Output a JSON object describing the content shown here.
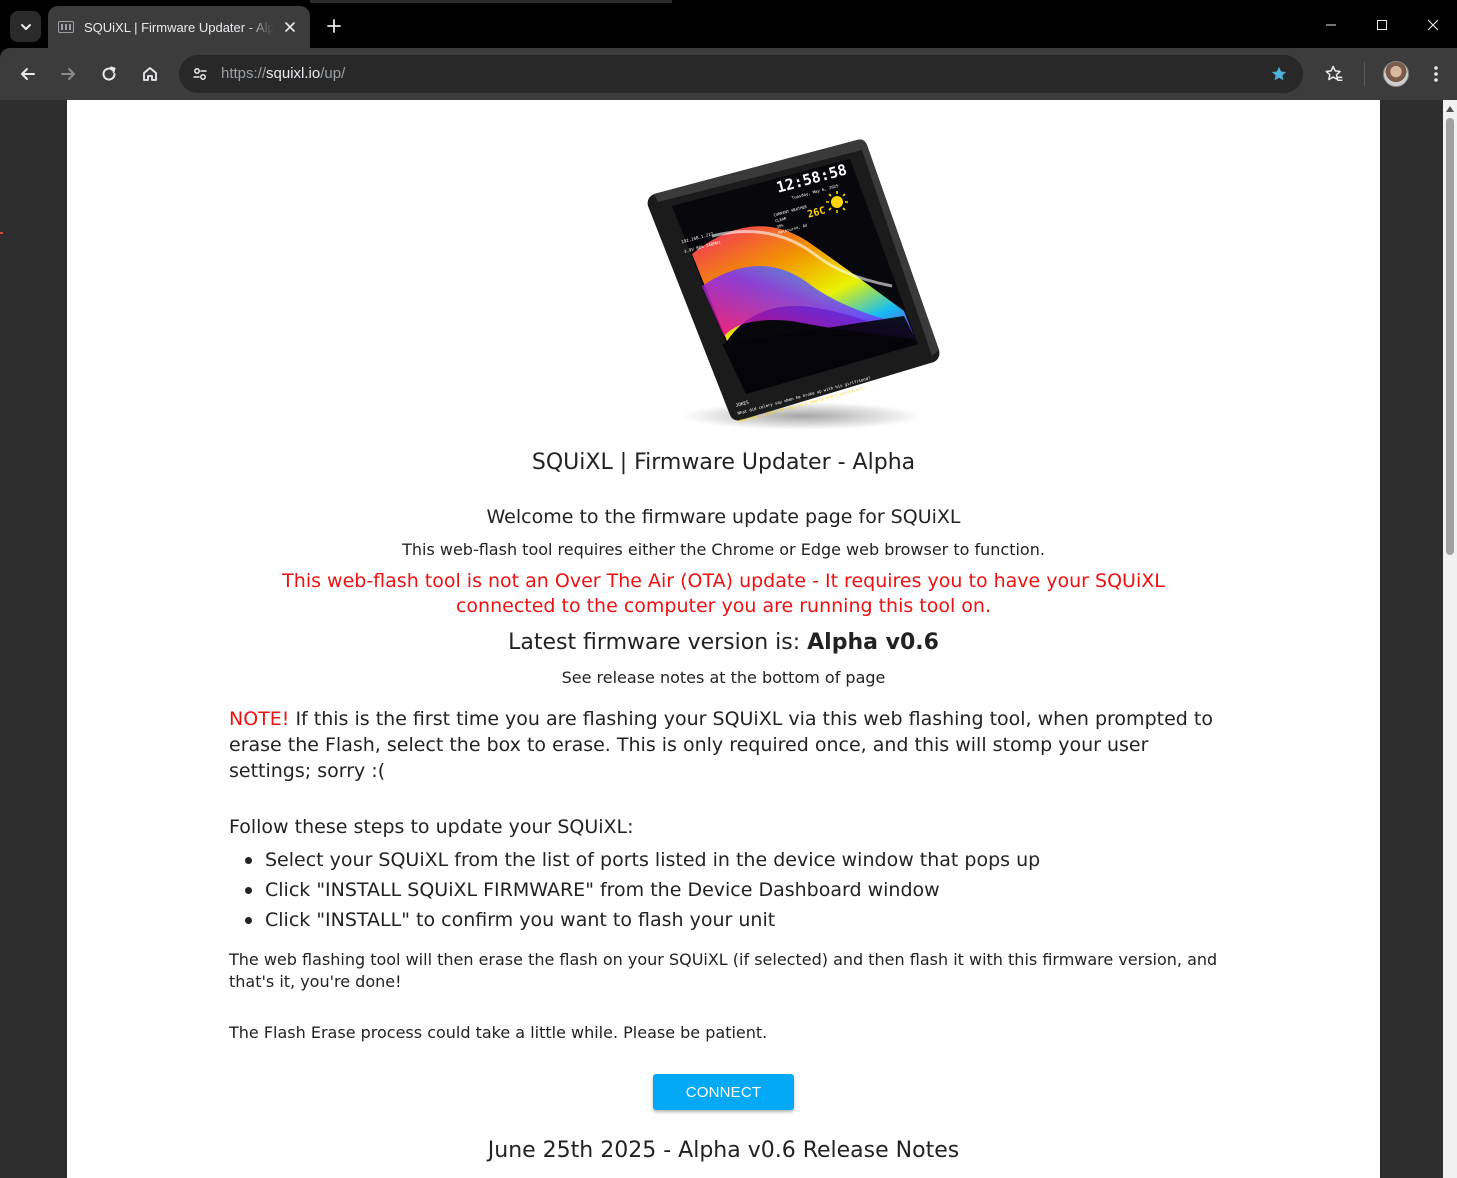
{
  "browser": {
    "tab": {
      "title": "SQUiXL | Firmware Updater - Alpha"
    },
    "address_bar": {
      "scheme": "https://",
      "host": "squixl.io",
      "path": "/up/"
    }
  },
  "page": {
    "title": "SQUiXL | Firmware Updater - Alpha",
    "welcome": "Welcome to the firmware update page for SQUiXL",
    "browser_requirement": "This web-flash tool requires either the Chrome or Edge web browser to function.",
    "ota_warning": "This web-flash tool is not an Over The Air (OTA) update - It requires you to have your SQUiXL connected to the computer you are running this tool on.",
    "latest_label": "Latest firmware version is: ",
    "latest_version": "Alpha v0.6",
    "release_hint": "See release notes at the bottom of page",
    "note_tag": "NOTE!",
    "note_text": " If this is the first time you are flashing your SQUiXL via this web flashing tool, when prompted to erase the Flash, select the box to erase. This is only required once, and this will stomp your user settings; sorry :(",
    "steps_heading": "Follow these steps to update your SQUiXL:",
    "steps": [
      "Select your SQUiXL from the list of ports listed in the device window that pops up",
      "Click \"INSTALL SQUiXL FIRMWARE\" from the Device Dashboard window",
      "Click \"INSTALL\" to confirm you want to flash your unit"
    ],
    "then_text": "The web flashing tool will then erase the flash on your SQUiXL (if selected) and then flash it with this firmware version, and that's it, you're done!",
    "patience_text": "The Flash Erase process could take a little while. Please be patient.",
    "connect_label": "CONNECT",
    "release_notes_title": "June 25th 2025 - Alpha v0.6 Release Notes",
    "device_screen": {
      "time": "12:58:58",
      "date": "Tuesday, May 6, 2025",
      "ip": "192.168.1.217",
      "wifi_info": "3.9V 80% 240MHz",
      "weather_label": "CURRENT WEATHER",
      "weather_cond": "CLEAR",
      "weather_extra": "38%",
      "location": "Melbourne, AU",
      "temperature": "26C",
      "jokes_title": "JOKES",
      "joke_q": "What did celery say when he broke up with his girlfriend?",
      "joke_a": "She wasn't right for me, so I really don't carrot all."
    }
  },
  "colors": {
    "accent_button": "#03a9f4",
    "warning_red": "#ee1111",
    "bookmark_star": "#4fb3d9"
  }
}
